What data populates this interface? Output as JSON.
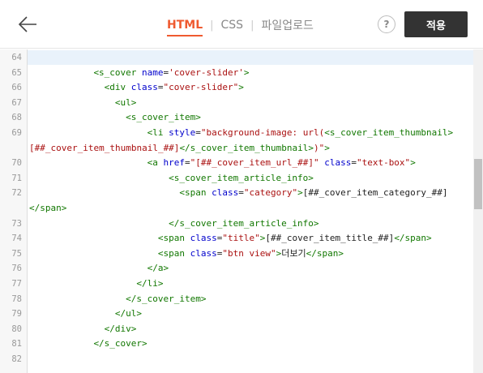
{
  "header": {
    "back_icon": "arrow-left-icon",
    "tabs": [
      {
        "label": "HTML",
        "active": true
      },
      {
        "label": "CSS",
        "active": false
      },
      {
        "label": "파일업로드",
        "active": false
      }
    ],
    "help_label": "?",
    "apply_label": "적용",
    "accent_color": "#ef5a30",
    "apply_bg": "#333333"
  },
  "editor": {
    "active_line": "64",
    "lines": [
      {
        "num": "64",
        "indent": 0,
        "tokens": []
      },
      {
        "num": "65",
        "indent": 6,
        "tokens": [
          {
            "k": "t",
            "v": "<s_cover"
          },
          {
            "k": "p",
            "v": " "
          },
          {
            "k": "a",
            "v": "name"
          },
          {
            "k": "p",
            "v": "="
          },
          {
            "k": "s",
            "v": "'cover-slider'"
          },
          {
            "k": "t",
            "v": ">"
          }
        ]
      },
      {
        "num": "66",
        "indent": 7,
        "tokens": [
          {
            "k": "t",
            "v": "<div"
          },
          {
            "k": "p",
            "v": " "
          },
          {
            "k": "a",
            "v": "class"
          },
          {
            "k": "p",
            "v": "="
          },
          {
            "k": "s",
            "v": "\"cover-slider\""
          },
          {
            "k": "t",
            "v": ">"
          }
        ]
      },
      {
        "num": "67",
        "indent": 8,
        "tokens": [
          {
            "k": "t",
            "v": "<ul>"
          }
        ]
      },
      {
        "num": "68",
        "indent": 9,
        "tokens": [
          {
            "k": "t",
            "v": "<s_cover_item>"
          }
        ]
      },
      {
        "num": "69",
        "indent": 11,
        "tokens": [
          {
            "k": "t",
            "v": "<li"
          },
          {
            "k": "p",
            "v": " "
          },
          {
            "k": "a",
            "v": "style"
          },
          {
            "k": "p",
            "v": "="
          },
          {
            "k": "s",
            "v": "\"background-image: url("
          },
          {
            "k": "t",
            "v": "<s_cover_item_thumbnail>"
          }
        ]
      },
      {
        "num": "",
        "indent": 0,
        "tokens": [
          {
            "k": "s",
            "v": "[##_cover_item_thumbnail_##]"
          },
          {
            "k": "t",
            "v": "</s_cover_item_thumbnail>"
          },
          {
            "k": "s",
            "v": ")\""
          },
          {
            "k": "t",
            "v": ">"
          }
        ]
      },
      {
        "num": "70",
        "indent": 11,
        "tokens": [
          {
            "k": "t",
            "v": "<a"
          },
          {
            "k": "p",
            "v": " "
          },
          {
            "k": "a",
            "v": "href"
          },
          {
            "k": "p",
            "v": "="
          },
          {
            "k": "s",
            "v": "\"[##_cover_item_url_##]\""
          },
          {
            "k": "p",
            "v": " "
          },
          {
            "k": "a",
            "v": "class"
          },
          {
            "k": "p",
            "v": "="
          },
          {
            "k": "s",
            "v": "\"text-box\""
          },
          {
            "k": "t",
            "v": ">"
          }
        ]
      },
      {
        "num": "71",
        "indent": 13,
        "tokens": [
          {
            "k": "t",
            "v": "<s_cover_item_article_info>"
          }
        ]
      },
      {
        "num": "72",
        "indent": 14,
        "tokens": [
          {
            "k": "t",
            "v": "<span"
          },
          {
            "k": "p",
            "v": " "
          },
          {
            "k": "a",
            "v": "class"
          },
          {
            "k": "p",
            "v": "="
          },
          {
            "k": "s",
            "v": "\"category\""
          },
          {
            "k": "t",
            "v": ">"
          },
          {
            "k": "p",
            "v": "[##_cover_item_category_##]"
          }
        ]
      },
      {
        "num": "",
        "indent": 0,
        "tokens": [
          {
            "k": "t",
            "v": "</span>"
          }
        ]
      },
      {
        "num": "73",
        "indent": 13,
        "tokens": [
          {
            "k": "t",
            "v": "</s_cover_item_article_info>"
          }
        ]
      },
      {
        "num": "74",
        "indent": 12,
        "tokens": [
          {
            "k": "t",
            "v": "<span"
          },
          {
            "k": "p",
            "v": " "
          },
          {
            "k": "a",
            "v": "class"
          },
          {
            "k": "p",
            "v": "="
          },
          {
            "k": "s",
            "v": "\"title\""
          },
          {
            "k": "t",
            "v": ">"
          },
          {
            "k": "p",
            "v": "[##_cover_item_title_##]"
          },
          {
            "k": "t",
            "v": "</span>"
          }
        ]
      },
      {
        "num": "75",
        "indent": 12,
        "tokens": [
          {
            "k": "t",
            "v": "<span"
          },
          {
            "k": "p",
            "v": " "
          },
          {
            "k": "a",
            "v": "class"
          },
          {
            "k": "p",
            "v": "="
          },
          {
            "k": "s",
            "v": "\"btn view\""
          },
          {
            "k": "t",
            "v": ">"
          },
          {
            "k": "p",
            "v": "더보기"
          },
          {
            "k": "t",
            "v": "</span>"
          }
        ]
      },
      {
        "num": "76",
        "indent": 11,
        "tokens": [
          {
            "k": "t",
            "v": "</a>"
          }
        ]
      },
      {
        "num": "77",
        "indent": 10,
        "tokens": [
          {
            "k": "t",
            "v": "</li>"
          }
        ]
      },
      {
        "num": "78",
        "indent": 9,
        "tokens": [
          {
            "k": "t",
            "v": "</s_cover_item>"
          }
        ]
      },
      {
        "num": "79",
        "indent": 8,
        "tokens": [
          {
            "k": "t",
            "v": "</ul>"
          }
        ]
      },
      {
        "num": "80",
        "indent": 7,
        "tokens": [
          {
            "k": "t",
            "v": "</div>"
          }
        ]
      },
      {
        "num": "81",
        "indent": 6,
        "tokens": [
          {
            "k": "t",
            "v": "</s_cover>"
          }
        ]
      },
      {
        "num": "82",
        "indent": 0,
        "tokens": []
      }
    ]
  }
}
